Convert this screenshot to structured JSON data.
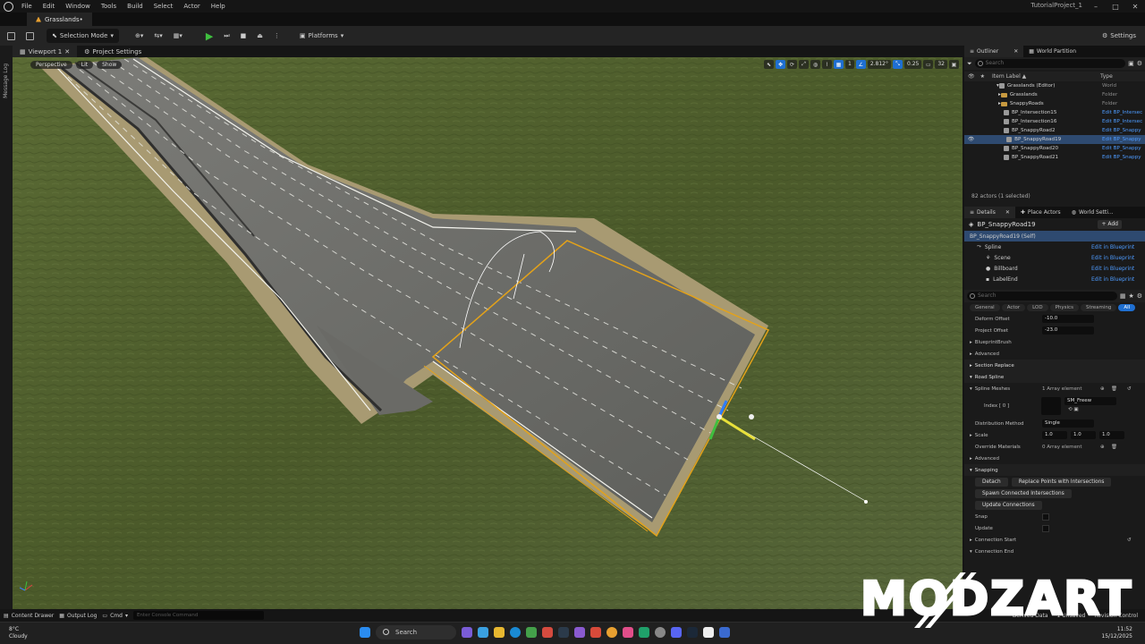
{
  "menubar": {
    "items": [
      "File",
      "Edit",
      "Window",
      "Tools",
      "Build",
      "Select",
      "Actor",
      "Help"
    ],
    "project": "TutorialProject_1"
  },
  "level_tab": {
    "label": "Grasslands•"
  },
  "toolbar": {
    "selection_mode": "Selection Mode",
    "platforms": "Platforms",
    "settings": "Settings"
  },
  "left_strip": {
    "label": "Message Log"
  },
  "viewport_tabs": {
    "viewport": "Viewport 1",
    "project_settings": "Project Settings"
  },
  "viewport": {
    "perspective": "Perspective",
    "lit": "Lit",
    "show": "Show",
    "snap_angle": "2.812°",
    "snap_scale": "0.25",
    "camera_speed": "32",
    "grid_size": "1"
  },
  "outliner": {
    "tab_outliner": "Outliner",
    "tab_world_partition": "World Partition",
    "search_placeholder": "Search",
    "col_label": "Item Label ▲",
    "col_type": "Type",
    "rows": [
      {
        "label": "Grasslands (Editor)",
        "type": "World"
      },
      {
        "label": "Grasslands",
        "type": "Folder"
      },
      {
        "label": "SnappyRoads",
        "type": "Folder"
      },
      {
        "label": "BP_Intersection15",
        "type": "Edit BP_Intersec"
      },
      {
        "label": "BP_Intersection16",
        "type": "Edit BP_Intersec"
      },
      {
        "label": "BP_SnappyRoad2",
        "type": "Edit BP_Snappy"
      },
      {
        "label": "BP_SnappyRoad19",
        "type": "Edit BP_Snappy"
      },
      {
        "label": "BP_SnappyRoad20",
        "type": "Edit BP_Snappy"
      },
      {
        "label": "BP_SnappyRoad21",
        "type": "Edit BP_Snappy"
      }
    ],
    "count": "82 actors (1 selected)"
  },
  "details": {
    "tab_details": "Details",
    "tab_place": "Place Actors",
    "tab_world": "World Setti...",
    "actor_name": "BP_SnappyRoad19",
    "add_label": "+ Add",
    "components": [
      {
        "label": "BP_SnappyRoad19 (Self)",
        "link": ""
      },
      {
        "label": "Spline",
        "link": "Edit in Blueprint"
      },
      {
        "label": "Scene",
        "link": "Edit in Blueprint"
      },
      {
        "label": "Billboard",
        "link": "Edit in Blueprint"
      },
      {
        "label": "LabelEnd",
        "link": "Edit in Blueprint"
      }
    ],
    "search_placeholder": "Search",
    "categories": [
      "General",
      "Actor",
      "LOD",
      "Physics",
      "Streaming",
      "All"
    ],
    "deform_offset_label": "Deform Offset",
    "deform_offset_value": "-10.0",
    "project_offset_label": "Project Offset",
    "project_offset_value": "-23.0",
    "blueprint_brush": "BlueprintBrush",
    "advanced": "Advanced",
    "section_replace": "Section Replace",
    "road_spline": "Road Spline",
    "spline_meshes_label": "Spline Meshes",
    "spline_meshes_value": "1 Array element",
    "index_label": "Index [ 0 ]",
    "mesh_name": "SM_Freew",
    "distribution_label": "Distribution Method",
    "distribution_value": "Single",
    "scale_label": "Scale",
    "scale_x": "1.0",
    "scale_y": "1.0",
    "scale_z": "1.0",
    "override_label": "Override Materials",
    "override_value": "0 Array element",
    "advanced2": "Advanced",
    "snapping": "Snapping",
    "detach": "Detach",
    "replace_points": "Replace Points with Intersections",
    "spawn_connected": "Spawn Connected Intersections",
    "update_connections": "Update Connections",
    "snap_label": "Snap",
    "update_label": "Update",
    "connection_start": "Connection Start",
    "connection_end": "Connection End"
  },
  "bottombar": {
    "content_drawer": "Content Drawer",
    "output_log": "Output Log",
    "cmd": "Cmd",
    "cmd_placeholder": "Enter Console Command",
    "derived_data": "Derived Data",
    "unsaved": "1 Unsaved",
    "revision": "Revision Control"
  },
  "taskbar": {
    "temp": "8°C",
    "weather": "Cloudy",
    "search": "Search",
    "time": "11:52",
    "date": "15/12/2025"
  },
  "watermark": {
    "text": "MODZART"
  },
  "colors": {
    "accent": "#1f6fd1",
    "play": "#3fbf3f",
    "link": "#4d9bff",
    "selection_outline": "#e3a21a",
    "grass": "#4a5a2c"
  }
}
